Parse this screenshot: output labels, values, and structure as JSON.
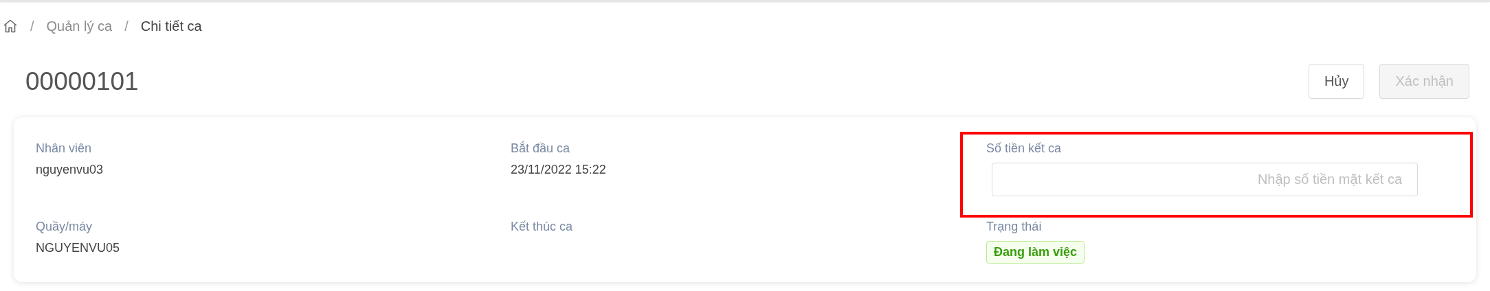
{
  "breadcrumb": {
    "items": [
      {
        "separator": "/",
        "label": "Quản lý ca",
        "current": false
      },
      {
        "separator": "/",
        "label": "Chi tiết ca",
        "current": true
      }
    ]
  },
  "title": "00000101",
  "actions": [
    {
      "label": "Hủy",
      "disabled": false
    },
    {
      "label": "Xác nhận",
      "disabled": true
    }
  ],
  "card": {
    "fields": [
      {
        "kind": "text",
        "label": "Nhân viên",
        "value": "nguyenvu03"
      },
      {
        "kind": "text",
        "label": "Bắt đầu ca",
        "value": "23/11/2022 15:22"
      },
      {
        "kind": "input",
        "label": "Số tiền kết ca",
        "placeholder": "Nhập số tiền mặt kết ca",
        "highlighted": true
      },
      {
        "kind": "text",
        "label": "Quầy/máy",
        "value": "NGUYENVU05"
      },
      {
        "kind": "text",
        "label": "Kết thúc ca"
      },
      {
        "kind": "badge",
        "label": "Trạng thái",
        "value": "Đang làm việc"
      }
    ]
  }
}
